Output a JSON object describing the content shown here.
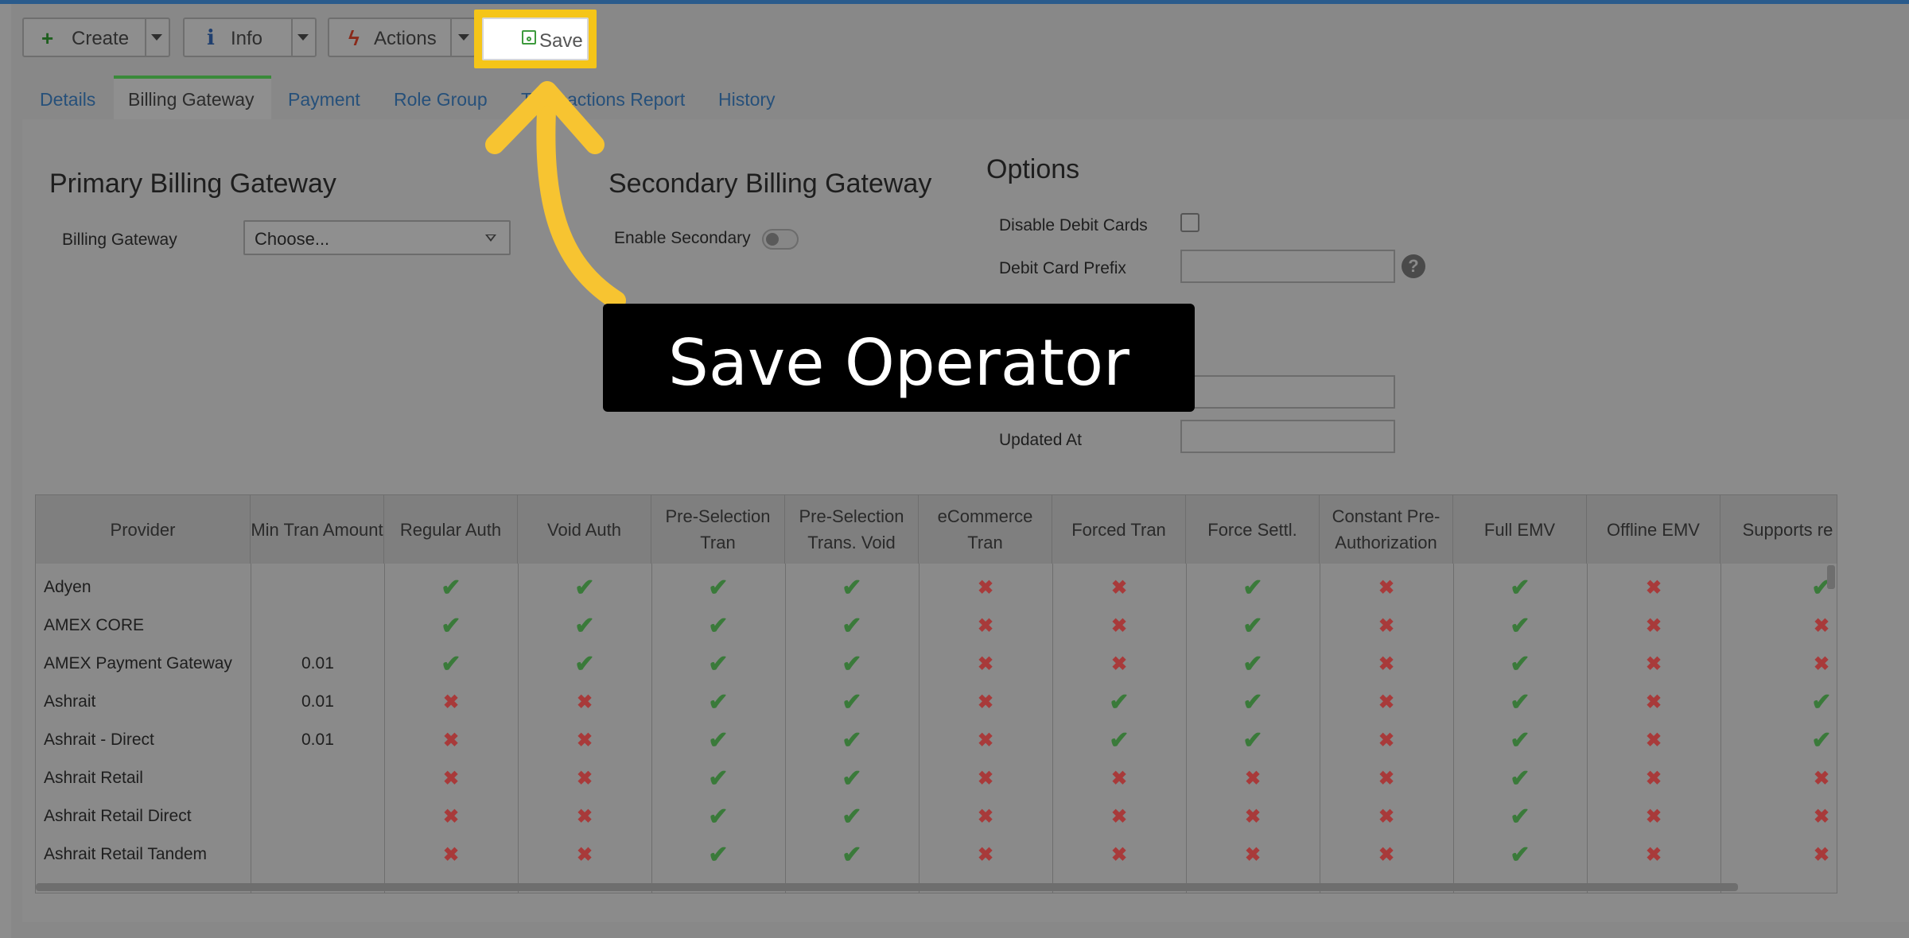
{
  "toolbar": {
    "create_label": "Create",
    "info_label": "Info",
    "actions_label": "Actions",
    "save_label": "Save"
  },
  "tabs": [
    {
      "label": "Details"
    },
    {
      "label": "Billing Gateway"
    },
    {
      "label": "Payment"
    },
    {
      "label": "Role Group"
    },
    {
      "label": "Transactions Report"
    },
    {
      "label": "History"
    }
  ],
  "primary": {
    "title": "Primary Billing Gateway",
    "gateway_label": "Billing Gateway",
    "gateway_value": "Choose..."
  },
  "secondary": {
    "title": "Secondary Billing Gateway",
    "enable_label": "Enable Secondary",
    "enabled": false
  },
  "options": {
    "title": "Options",
    "disable_debit_label": "Disable Debit Cards",
    "debit_prefix_label": "Debit Card Prefix",
    "updated_at_label": "Updated At"
  },
  "annotation": {
    "text": "Save Operator"
  },
  "table": {
    "columns": [
      "Provider",
      "Min Tran Amount",
      "Regular Auth",
      "Void Auth",
      "Pre-Selection Tran",
      "Pre-Selection Trans. Void",
      "eCommerce Tran",
      "Forced Tran",
      "Force Settl.",
      "Constant Pre-Authorization",
      "Full EMV",
      "Offline EMV",
      "Supports re"
    ],
    "rows": [
      {
        "provider": "Adyen",
        "min": "",
        "flags": [
          1,
          1,
          1,
          1,
          0,
          0,
          1,
          0,
          1,
          0,
          1
        ]
      },
      {
        "provider": "AMEX CORE",
        "min": "",
        "flags": [
          1,
          1,
          1,
          1,
          0,
          0,
          1,
          0,
          1,
          0,
          0
        ]
      },
      {
        "provider": "AMEX Payment Gateway",
        "min": "0.01",
        "flags": [
          1,
          1,
          1,
          1,
          0,
          0,
          1,
          0,
          1,
          0,
          0
        ]
      },
      {
        "provider": "Ashrait",
        "min": "0.01",
        "flags": [
          0,
          0,
          1,
          1,
          0,
          1,
          1,
          0,
          1,
          0,
          1
        ]
      },
      {
        "provider": "Ashrait - Direct",
        "min": "0.01",
        "flags": [
          0,
          0,
          1,
          1,
          0,
          1,
          1,
          0,
          1,
          0,
          1
        ]
      },
      {
        "provider": "Ashrait Retail",
        "min": "",
        "flags": [
          0,
          0,
          1,
          1,
          0,
          0,
          0,
          0,
          1,
          0,
          0
        ]
      },
      {
        "provider": "Ashrait Retail Direct",
        "min": "",
        "flags": [
          0,
          0,
          1,
          1,
          0,
          0,
          0,
          0,
          1,
          0,
          0
        ]
      },
      {
        "provider": "Ashrait Retail Tandem",
        "min": "",
        "flags": [
          0,
          0,
          1,
          1,
          0,
          0,
          0,
          0,
          1,
          0,
          0
        ]
      }
    ]
  }
}
